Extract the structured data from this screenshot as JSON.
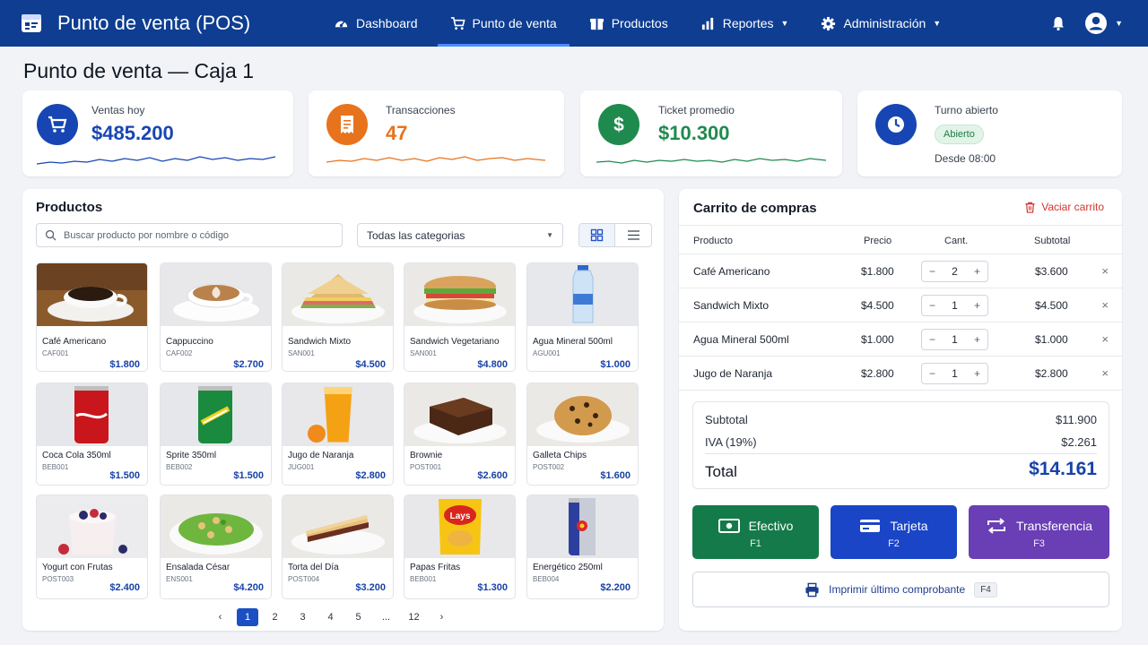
{
  "app": {
    "title": "Punto de venta (POS)"
  },
  "nav": [
    {
      "label": "Dashboard",
      "icon": "gauge-icon"
    },
    {
      "label": "Punto de venta",
      "icon": "cart-icon",
      "active": true
    },
    {
      "label": "Productos",
      "icon": "box-icon"
    },
    {
      "label": "Reportes",
      "icon": "bar-chart-icon",
      "dropdown": true
    },
    {
      "label": "Administración",
      "icon": "gear-icon",
      "dropdown": true
    }
  ],
  "page": {
    "title": "Punto de venta — Caja 1"
  },
  "stats": {
    "sales": {
      "label": "Ventas hoy",
      "value": "$485.200",
      "color": "#1745b3"
    },
    "transactions": {
      "label": "Transacciones",
      "value": "47",
      "color": "#e8731d"
    },
    "avg_ticket": {
      "label": "Ticket promedio",
      "value": "$10.300",
      "color": "#1f8a4e"
    },
    "shift": {
      "label": "Turno abierto",
      "status": "Abierto",
      "since": "Desde 08:00",
      "color": "#1745b3"
    }
  },
  "products_panel": {
    "title": "Productos",
    "search_placeholder": "Buscar producto por nombre o código",
    "category": "Todas las categorias",
    "items": [
      {
        "name": "Café Americano",
        "sku": "CAF001",
        "price": "$1.800",
        "icon": "coffee-cup-icon"
      },
      {
        "name": "Cappuccino",
        "sku": "CAF002",
        "price": "$2.700",
        "icon": "cappuccino-icon"
      },
      {
        "name": "Sandwich Mixto",
        "sku": "SAN001",
        "price": "$4.500",
        "icon": "sandwich-icon"
      },
      {
        "name": "Sandwich Vegetariano",
        "sku": "SAN001",
        "price": "$4.800",
        "icon": "veggie-sandwich-icon"
      },
      {
        "name": "Agua Mineral 500ml",
        "sku": "AGU001",
        "price": "$1.000",
        "icon": "water-bottle-icon"
      },
      {
        "name": "Coca Cola 350ml",
        "sku": "BEB001",
        "price": "$1.500",
        "icon": "red-can-icon"
      },
      {
        "name": "Sprite 350ml",
        "sku": "BEB002",
        "price": "$1.500",
        "icon": "green-can-icon"
      },
      {
        "name": "Jugo de Naranja",
        "sku": "JUG001",
        "price": "$2.800",
        "icon": "orange-juice-icon"
      },
      {
        "name": "Brownie",
        "sku": "POST001",
        "price": "$2.600",
        "icon": "brownie-icon"
      },
      {
        "name": "Galleta Chips",
        "sku": "POST002",
        "price": "$1.600",
        "icon": "cookie-icon"
      },
      {
        "name": "Yogurt con Frutas",
        "sku": "POST003",
        "price": "$2.400",
        "icon": "yogurt-icon"
      },
      {
        "name": "Ensalada César",
        "sku": "ENS001",
        "price": "$4.200",
        "icon": "salad-icon"
      },
      {
        "name": "Torta del Día",
        "sku": "POST004",
        "price": "$3.200",
        "icon": "cake-slice-icon"
      },
      {
        "name": "Papas Fritas",
        "sku": "BEB001",
        "price": "$1.300",
        "icon": "chips-bag-icon"
      },
      {
        "name": "Energético 250ml",
        "sku": "BEB004",
        "price": "$2.200",
        "icon": "energy-can-icon"
      }
    ],
    "pagination": {
      "prev": "‹",
      "pages": [
        "1",
        "2",
        "3",
        "4",
        "5",
        "...",
        "12"
      ],
      "current": "1",
      "next": "›"
    }
  },
  "cart": {
    "title": "Carrito de compras",
    "clear_label": "Vaciar carrito",
    "headers": {
      "product": "Producto",
      "price": "Precio",
      "qty": "Cant.",
      "subtotal": "Subtotal"
    },
    "items": [
      {
        "name": "Café Americano",
        "price": "$1.800",
        "qty": "2",
        "subtotal": "$3.600"
      },
      {
        "name": "Sandwich Mixto",
        "price": "$4.500",
        "qty": "1",
        "subtotal": "$4.500"
      },
      {
        "name": "Agua Mineral 500ml",
        "price": "$1.000",
        "qty": "1",
        "subtotal": "$1.000"
      },
      {
        "name": "Jugo de Naranja",
        "price": "$2.800",
        "qty": "1",
        "subtotal": "$2.800"
      }
    ],
    "summary": {
      "subtotal_label": "Subtotal",
      "subtotal": "$11.900",
      "tax_label": "IVA (19%)",
      "tax": "$2.261",
      "total_label": "Total",
      "total": "$14.161"
    },
    "payments": [
      {
        "label": "Efectivo",
        "key": "F1",
        "color": "#157a4a",
        "icon": "cash-icon"
      },
      {
        "label": "Tarjeta",
        "key": "F2",
        "color": "#1a45c6",
        "icon": "credit-card-icon"
      },
      {
        "label": "Transferencia",
        "key": "F3",
        "color": "#6a3eb5",
        "icon": "transfer-icon"
      }
    ],
    "print": {
      "label": "Imprimir último comprobante",
      "key": "F4"
    }
  }
}
